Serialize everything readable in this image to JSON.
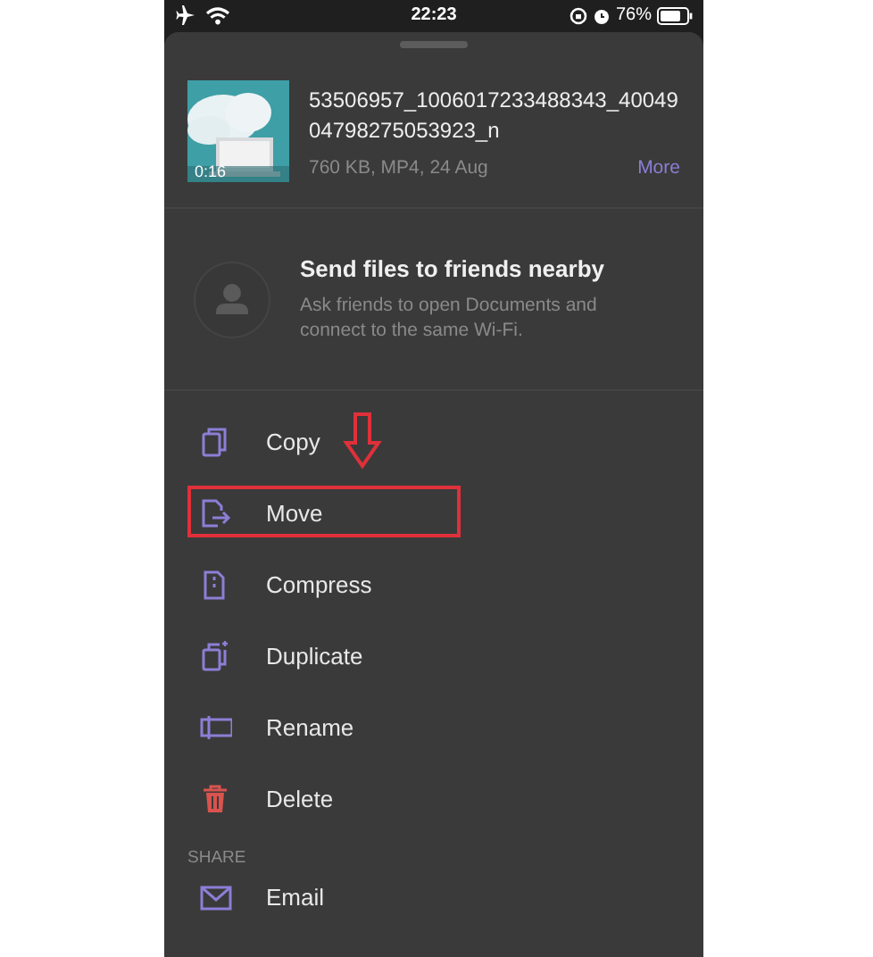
{
  "status_bar": {
    "time": "22:23",
    "battery": "76%"
  },
  "file": {
    "name": "53506957_1006017233488343_4004904798275053923_n",
    "meta": "760 KB, MP4, 24 Aug",
    "more": "More",
    "duration": "0:16"
  },
  "nearby": {
    "title": "Send files to friends nearby",
    "text": "Ask friends to open Documents and connect to the same Wi-Fi."
  },
  "actions": [
    {
      "label": "Copy",
      "kind": "copy",
      "highlighted": false
    },
    {
      "label": "Move",
      "kind": "move",
      "highlighted": true
    },
    {
      "label": "Compress",
      "kind": "compress",
      "highlighted": false
    },
    {
      "label": "Duplicate",
      "kind": "duplicate",
      "highlighted": false
    },
    {
      "label": "Rename",
      "kind": "rename",
      "highlighted": false
    },
    {
      "label": "Delete",
      "kind": "delete",
      "highlighted": false
    }
  ],
  "share": {
    "heading": "SHARE",
    "items": [
      {
        "label": "Email",
        "kind": "email"
      }
    ]
  }
}
